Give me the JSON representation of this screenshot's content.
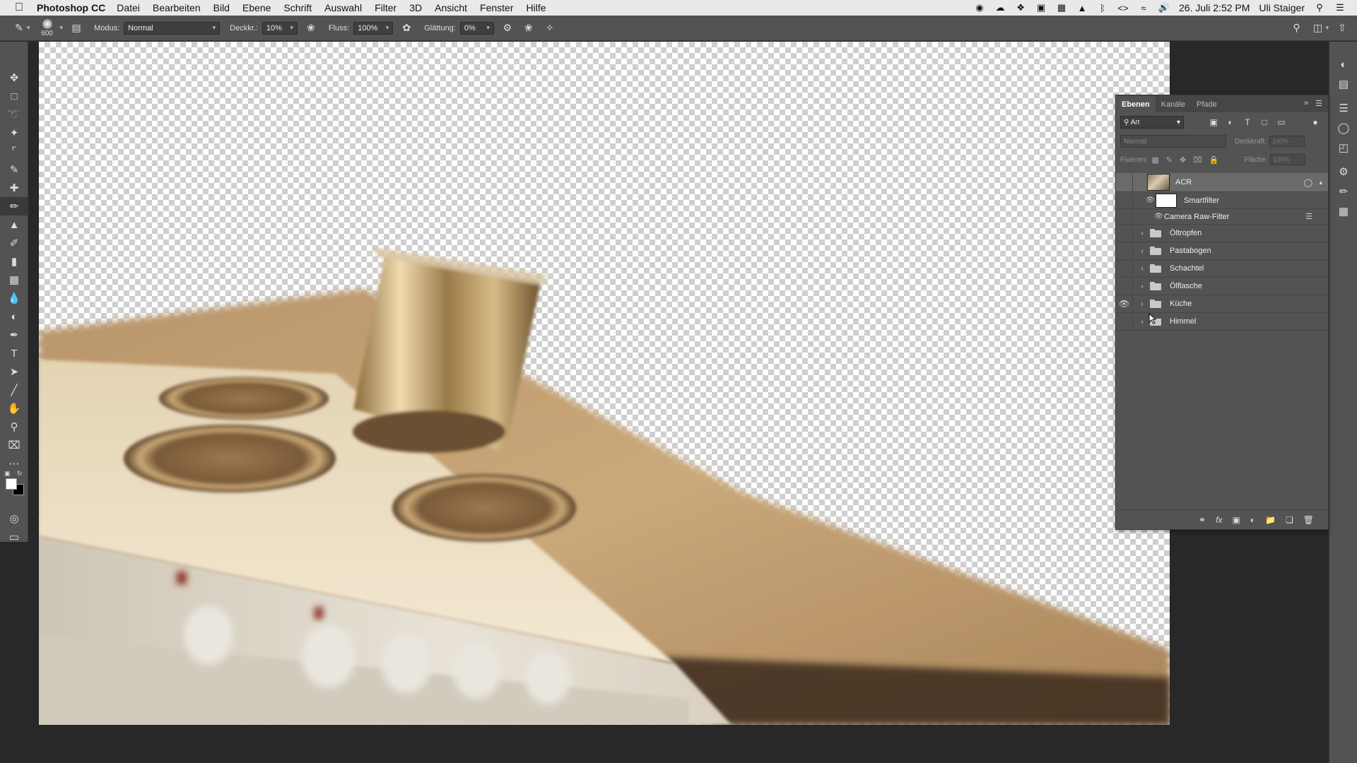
{
  "menubar": {
    "app_name": "Photoshop CC",
    "menus": [
      "Datei",
      "Bearbeiten",
      "Bild",
      "Ebene",
      "Schrift",
      "Auswahl",
      "Filter",
      "3D",
      "Ansicht",
      "Fenster",
      "Hilfe"
    ],
    "datetime": "26. Juli  2:52 PM",
    "user": "Uli Staiger"
  },
  "options": {
    "brush_size": "600",
    "mode_label": "Modus:",
    "mode_value": "Normal",
    "opacity_label": "Deckkr.:",
    "opacity_value": "10%",
    "flow_label": "Fluss:",
    "flow_value": "100%",
    "smoothing_label": "Glättung:",
    "smoothing_value": "0%"
  },
  "colors": {
    "ui_panel": "#535353",
    "canvas_bg": "#282828",
    "selected_row": "#6a6a6a",
    "foreground": "#ffffff",
    "background": "#000000"
  },
  "layers_panel": {
    "tabs": [
      "Ebenen",
      "Kanäle",
      "Pfade"
    ],
    "filter_value": "Art",
    "blend_value": "Normal",
    "opacity_label": "Deckkraft:",
    "opacity_value": "100%",
    "lock_label": "Fixieren:",
    "fill_label": "Fläche:",
    "fill_value": "100%",
    "smart_layer": {
      "name": "ACR",
      "smartfilter_label": "Smartfilter",
      "filter_name": "Camera Raw-Filter"
    },
    "groups": [
      {
        "name": "Öltropfen",
        "visible": false
      },
      {
        "name": "Pastabogen",
        "visible": false
      },
      {
        "name": "Schachtel",
        "visible": false
      },
      {
        "name": "Ölflasche",
        "visible": false
      },
      {
        "name": "Küche",
        "visible": true
      },
      {
        "name": "Himmel",
        "visible": false
      }
    ]
  }
}
